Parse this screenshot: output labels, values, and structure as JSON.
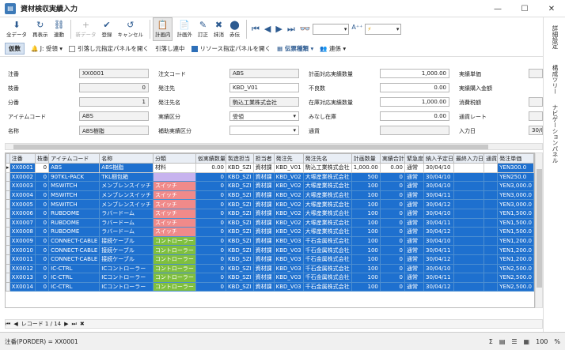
{
  "window": {
    "title": "資材検収実績入力"
  },
  "toolbar": {
    "buttons": [
      {
        "label": "全データ",
        "icon": "⬇"
      },
      {
        "label": "再表示",
        "icon": "↻"
      },
      {
        "label": "連動",
        "icon": "⛓"
      },
      {
        "label": "新データ",
        "icon": "+",
        "disabled": true
      },
      {
        "label": "登録",
        "icon": "✔"
      },
      {
        "label": "キャンセル",
        "icon": "↺"
      },
      {
        "label": "計画内",
        "icon": "📋",
        "active": true
      },
      {
        "label": "計画外",
        "icon": "📄"
      },
      {
        "label": "訂正",
        "icon": "✎"
      },
      {
        "label": "抹消",
        "icon": "✖"
      },
      {
        "label": "赤伝",
        "icon": "⬤"
      }
    ],
    "nav": [
      "⏮",
      "◀",
      "▶",
      "⏭"
    ],
    "binoculars": "👓",
    "font_label": "A⁺⁺",
    "search_combo": "",
    "filter_combo": ""
  },
  "toolbar2": {
    "pill": "仮数",
    "receive_mode": "J: 受領",
    "toggle1": "引落し元指定パネルを開く",
    "status": "引落し連中",
    "toggle2": "リソース指定パネルを開く",
    "slip_type": "伝票種類",
    "contact": "連係"
  },
  "form": {
    "order_no_label": "注番",
    "order_no": "XX0001",
    "branch_label": "枝番",
    "branch": "0",
    "split_label": "分番",
    "split": "1",
    "item_code_label": "アイテムコード",
    "item_code": "ABS",
    "name_label": "名称",
    "name": "ABS樹脂",
    "po_code_label": "注文コード",
    "po_code": "ABS",
    "supplier_label": "発注先",
    "supplier": "KBD_V01",
    "supplier_name_label": "発注先名",
    "supplier_name": "駒込工業株式会社",
    "result_cat_label": "実績区分",
    "result_cat": "受領",
    "aux_cat_label": "補助実績区分",
    "aux_cat": "",
    "plan_qty_label": "計画対応実績数量",
    "plan_qty": "1,000.00",
    "defect_label": "不良数",
    "defect": "0.00",
    "stock_qty_label": "在庫対応実績数量",
    "stock_qty": "1,000.00",
    "deemed_label": "みなし在庫",
    "deemed": "0.00",
    "currency_label": "通貨",
    "currency": "",
    "unit_price_label": "実績単価",
    "unit_price": "",
    "receive_amt_label": "実績購入金額",
    "receive_amt": "",
    "tax_label": "消費税額",
    "tax": "",
    "rate_label": "通貨レート",
    "rate": "",
    "input_date_label": "入力日",
    "input_date": "30/0"
  },
  "side": {
    "tabs": [
      "詳細設定",
      "構成ツリー",
      "ナビゲーションパネル"
    ]
  },
  "grid": {
    "headers": [
      "注番",
      "枝番",
      "アイテムコード",
      "名称",
      "分類",
      "仮実績数量",
      "製造担当",
      "担当者",
      "発注先",
      "発注先名",
      "計画数量",
      "実績合計",
      "緊急度",
      "納入予定日",
      "最終入力日",
      "通貨",
      "発注単価"
    ],
    "rows": [
      [
        "XX0001",
        "0",
        "ABS",
        "ABS樹脂",
        "材料",
        "0.00",
        "KBD_SZI",
        "資材課",
        "KBD_V01",
        "駒込工業株式会社",
        "1,000.00",
        "0.00",
        "通常",
        "30/04/10",
        "",
        "",
        "YEN300.0"
      ],
      [
        "XX0002",
        "0",
        "90TKL-PACK",
        "TKL梱包箱",
        "",
        "0",
        "KBD_SZI",
        "資材課",
        "KBD_V02",
        "大塚産業株式会社",
        "500",
        "0",
        "通常",
        "30/04/10",
        "",
        "",
        "YEN250.0"
      ],
      [
        "XX0003",
        "0",
        "MSWITCH",
        "メンブレンスイッチ",
        "スイッチ",
        "0",
        "KBD_SZI",
        "資材課",
        "KBD_V02",
        "大塚産業株式会社",
        "100",
        "0",
        "通常",
        "30/04/10",
        "",
        "",
        "YEN3,000.0"
      ],
      [
        "XX0004",
        "0",
        "MSWITCH",
        "メンブレンスイッチ",
        "スイッチ",
        "0",
        "KBD_SZI",
        "資材課",
        "KBD_V02",
        "大塚産業株式会社",
        "100",
        "0",
        "通常",
        "30/04/11",
        "",
        "",
        "YEN3,000.0"
      ],
      [
        "XX0005",
        "0",
        "MSWITCH",
        "メンブレンスイッチ",
        "スイッチ",
        "0",
        "KBD_SZI",
        "資材課",
        "KBD_V02",
        "大塚産業株式会社",
        "100",
        "0",
        "通常",
        "30/04/12",
        "",
        "",
        "YEN3,000.0"
      ],
      [
        "XX0006",
        "0",
        "RUBDOME",
        "ラバードーム",
        "スイッチ",
        "0",
        "KBD_SZI",
        "資材課",
        "KBD_V02",
        "大塚産業株式会社",
        "100",
        "0",
        "通常",
        "30/04/10",
        "",
        "",
        "YEN1,500.0"
      ],
      [
        "XX0007",
        "0",
        "RUBDOME",
        "ラバードーム",
        "スイッチ",
        "0",
        "KBD_SZI",
        "資材課",
        "KBD_V02",
        "大塚産業株式会社",
        "100",
        "0",
        "通常",
        "30/04/11",
        "",
        "",
        "YEN1,500.0"
      ],
      [
        "XX0008",
        "0",
        "RUBDOME",
        "ラバードーム",
        "スイッチ",
        "0",
        "KBD_SZI",
        "資材課",
        "KBD_V02",
        "大塚産業株式会社",
        "100",
        "0",
        "通常",
        "30/04/12",
        "",
        "",
        "YEN1,500.0"
      ],
      [
        "XX0009",
        "0",
        "CONNECT-CABLE",
        "接続ケーブル",
        "コントローラー",
        "0",
        "KBD_SZI",
        "資材課",
        "KBD_V03",
        "千石金属株式会社",
        "100",
        "0",
        "通常",
        "30/04/10",
        "",
        "",
        "YEN1,200.0"
      ],
      [
        "XX0010",
        "0",
        "CONNECT-CABLE",
        "接続ケーブル",
        "コントローラー",
        "0",
        "KBD_SZI",
        "資材課",
        "KBD_V03",
        "千石金属株式会社",
        "100",
        "0",
        "通常",
        "30/04/11",
        "",
        "",
        "YEN1,200.0"
      ],
      [
        "XX0011",
        "0",
        "CONNECT-CABLE",
        "接続ケーブル",
        "コントローラー",
        "0",
        "KBD_SZI",
        "資材課",
        "KBD_V03",
        "千石金属株式会社",
        "100",
        "0",
        "通常",
        "30/04/12",
        "",
        "",
        "YEN1,200.0"
      ],
      [
        "XX0012",
        "0",
        "IC-CTRL",
        "ICコントローラー",
        "コントローラー",
        "0",
        "KBD_SZI",
        "資材課",
        "KBD_V03",
        "千石金属株式会社",
        "100",
        "0",
        "通常",
        "30/04/10",
        "",
        "",
        "YEN2,500.0"
      ],
      [
        "XX0013",
        "0",
        "IC-CTRL",
        "ICコントローラー",
        "コントローラー",
        "0",
        "KBD_SZI",
        "資材課",
        "KBD_V03",
        "千石金属株式会社",
        "100",
        "0",
        "通常",
        "30/04/11",
        "",
        "",
        "YEN2,500.0"
      ],
      [
        "XX0014",
        "0",
        "IC-CTRL",
        "ICコントローラー",
        "コントローラー",
        "0",
        "KBD_SZI",
        "資材課",
        "KBD_V03",
        "千石金属株式会社",
        "100",
        "0",
        "通常",
        "30/04/12",
        "",
        "",
        "YEN2,500.0"
      ]
    ]
  },
  "pager": {
    "label": "レコード 1 / 14"
  },
  "status": {
    "text": "注番(PORDER) = XX0001",
    "zoom": "100",
    "percent": "%",
    "sigma": "Σ"
  }
}
